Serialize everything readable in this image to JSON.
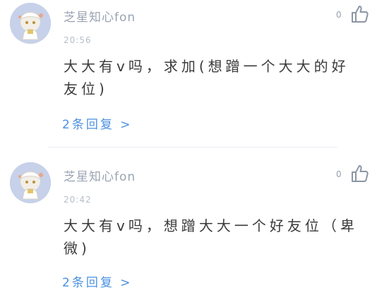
{
  "comments": [
    {
      "username": "芝星知心fon",
      "time": "20:56",
      "likes": "0",
      "text": "大大有v吗，求加(想蹭一个大大的好友位)",
      "replies_label": "2条回复",
      "replies_arrow": ">"
    },
    {
      "username": "芝星知心fon",
      "time": "20:42",
      "likes": "0",
      "text": "大大有v吗，想蹭大大一个好友位（卑微)",
      "replies_label": "2条回复",
      "replies_arrow": ">"
    }
  ],
  "colors": {
    "accent": "#4a90e2",
    "muted": "#9aa4b3",
    "text": "#3b3b3b",
    "avatar_bg": "#c7d1e9"
  },
  "icons": {
    "like": "thumbs-up-icon",
    "avatar": "user-avatar"
  }
}
